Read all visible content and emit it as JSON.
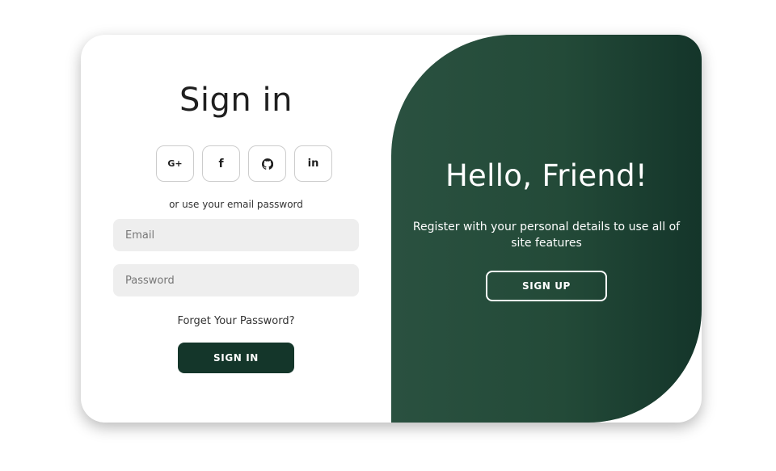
{
  "signin": {
    "title": "Sign in",
    "socials": [
      {
        "label": "G+",
        "icon": "google-plus-icon"
      },
      {
        "label": "f",
        "icon": "facebook-icon"
      },
      {
        "label": "",
        "icon": "github-icon"
      },
      {
        "label": "in",
        "icon": "linkedin-icon"
      }
    ],
    "alt_text": "or use your email password",
    "email_placeholder": "Email",
    "password_placeholder": "Password",
    "forgot_label": "Forget Your Password?",
    "button_label": "SIGN IN"
  },
  "toggle": {
    "title": "Hello, Friend!",
    "subtitle": "Register with your personal details to use all of site features",
    "button_label": "SIGN UP"
  },
  "colors": {
    "primary": "#14362a",
    "panel_start": "#2a5140",
    "panel_end": "#14352a",
    "input_bg": "#eeeeee"
  }
}
